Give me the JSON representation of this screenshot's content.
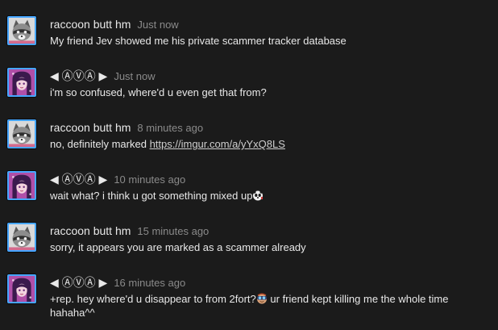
{
  "colors": {
    "background": "#1b1b1b",
    "text": "#e8e8e8",
    "timestamp": "#8a8a8a",
    "avatar_border": "#46a6ff"
  },
  "comments": [
    {
      "author": "raccoon butt hm",
      "time": "Just now",
      "avatar_icon": "raccoon-avatar-icon",
      "text": "My friend Jev showed me his private scammer tracker database"
    },
    {
      "author": "◀ ⒶⓋⒶ ▶",
      "time": "Just now",
      "avatar_icon": "purple-hair-girl-avatar-icon",
      "text": "i'm so confused, where'd u even get that from?"
    },
    {
      "author": "raccoon butt hm",
      "time": "8 minutes ago",
      "avatar_icon": "raccoon-avatar-icon",
      "text": "no, definitely marked ",
      "link": "https://imgur.com/a/yYxQ8LS"
    },
    {
      "author": "◀ ⒶⓋⒶ ▶",
      "time": "10 minutes ago",
      "avatar_icon": "purple-hair-girl-avatar-icon",
      "text": "wait what? i think u got something mixed up",
      "emote_icon": "panda-emote-icon"
    },
    {
      "author": "raccoon butt hm",
      "time": "15 minutes ago",
      "avatar_icon": "raccoon-avatar-icon",
      "text": "sorry, it appears you are marked as a scammer already"
    },
    {
      "author": "◀ ⒶⓋⒶ ▶",
      "time": "16 minutes ago",
      "avatar_icon": "purple-hair-girl-avatar-icon",
      "text": "+rep. hey where'd u disappear to from 2fort?",
      "emote_icon": "goggles-emote-icon",
      "text_after": " ur friend kept killing me the whole time hahaha^^"
    }
  ]
}
